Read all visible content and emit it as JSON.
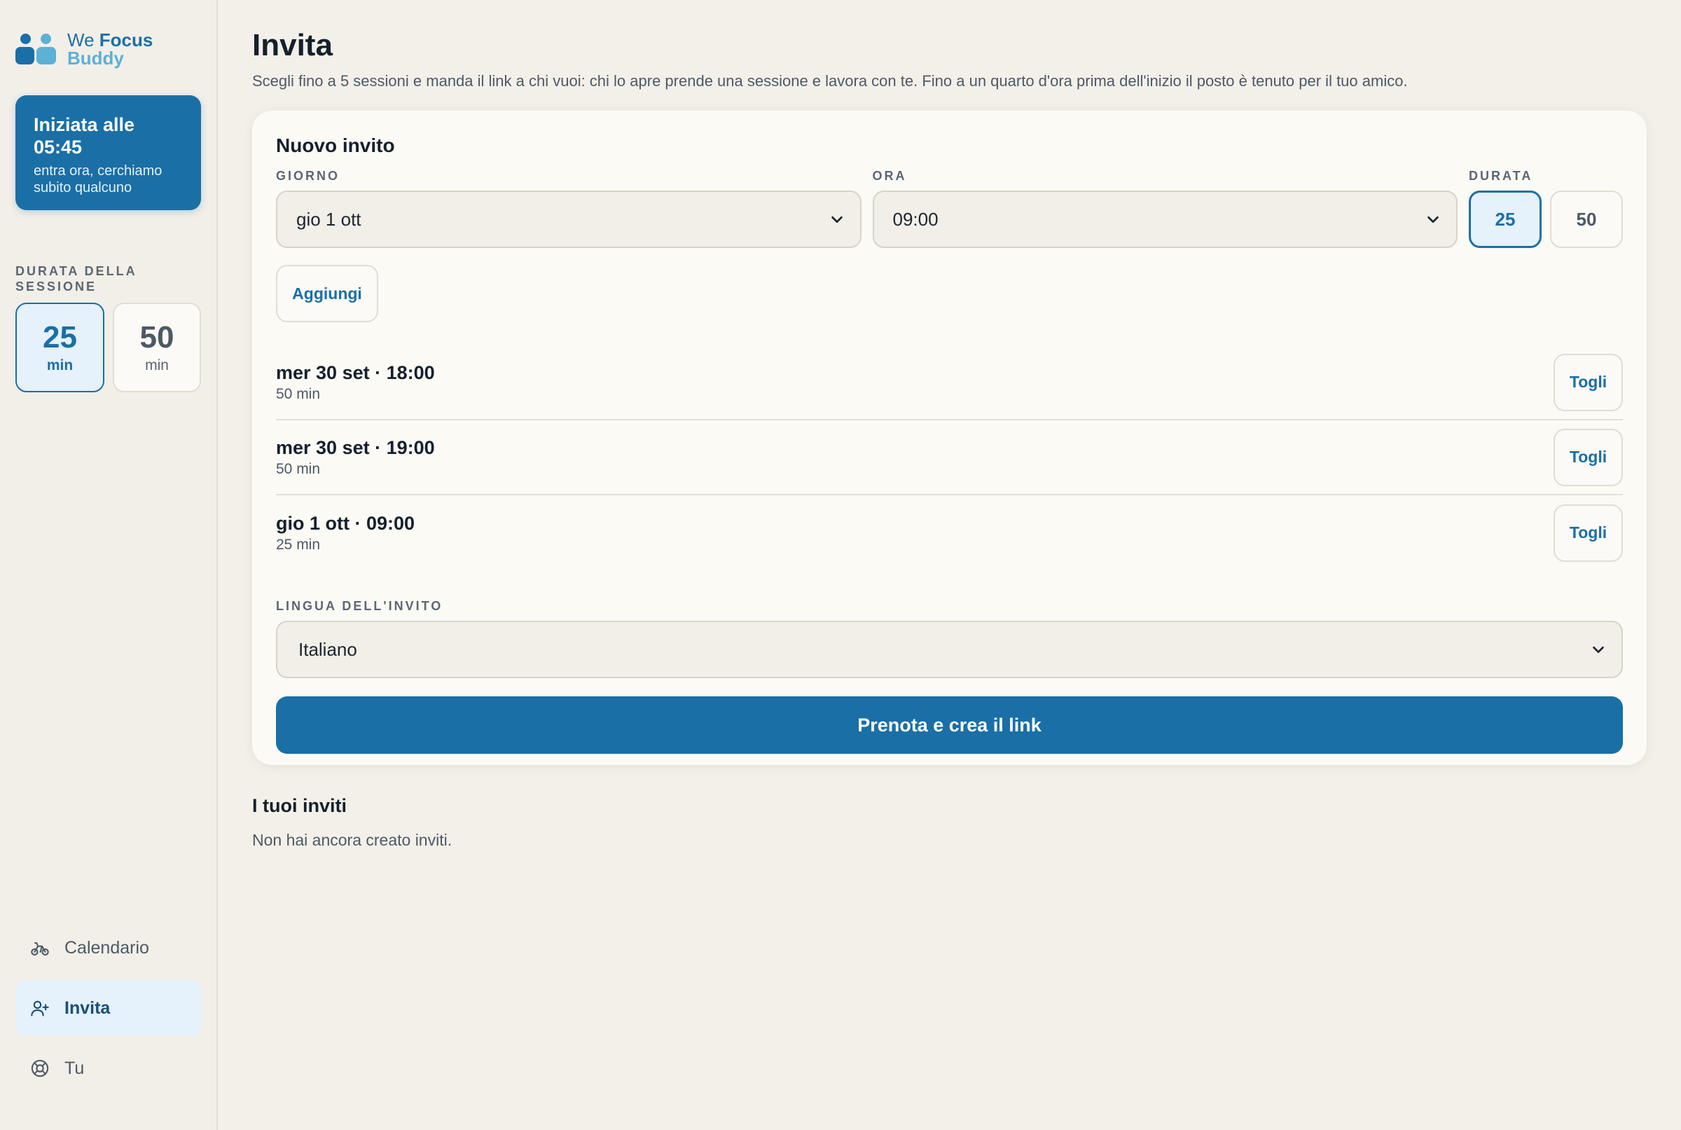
{
  "brand": {
    "we": "We",
    "focus": "Focus",
    "buddy": "Buddy"
  },
  "started_card": {
    "title": "Iniziata alle 05:45",
    "subtitle": "entra ora, cerchiamo subito qualcuno"
  },
  "session_duration": {
    "label": "DURATA DELLA SESSIONE",
    "options": [
      {
        "value": "25",
        "unit": "min",
        "selected": true
      },
      {
        "value": "50",
        "unit": "min",
        "selected": false
      }
    ]
  },
  "nav": [
    {
      "label": "Calendario",
      "icon": "bicycle-icon",
      "active": false
    },
    {
      "label": "Invita",
      "icon": "user-plus-icon",
      "active": true
    },
    {
      "label": "Tu",
      "icon": "lifebuoy-icon",
      "active": false
    }
  ],
  "page": {
    "title": "Invita",
    "subtitle": "Scegli fino a 5 sessioni e manda il link a chi vuoi: chi lo apre prende una sessione e lavora con te. Fino a un quarto d'ora prima dell'inizio il posto è tenuto per il tuo amico."
  },
  "form": {
    "title": "Nuovo invito",
    "day_label": "GIORNO",
    "day_value": "gio 1 ott",
    "time_label": "ORA",
    "time_value": "09:00",
    "duration_label": "DURATA",
    "durations": [
      {
        "value": "25",
        "selected": true
      },
      {
        "value": "50",
        "selected": false
      }
    ],
    "add_label": "Aggiungi",
    "slots": [
      {
        "when": "mer 30 set · 18:00",
        "duration": "50 min",
        "remove_label": "Togli"
      },
      {
        "when": "mer 30 set · 19:00",
        "duration": "50 min",
        "remove_label": "Togli"
      },
      {
        "when": "gio 1 ott · 09:00",
        "duration": "25 min",
        "remove_label": "Togli"
      }
    ],
    "language_label": "LINGUA DELL'INVITO",
    "language_value": "Italiano",
    "submit_label": "Prenota e crea il link"
  },
  "invites": {
    "title": "I tuoi inviti",
    "empty": "Non hai ancora creato inviti."
  },
  "colors": {
    "accent": "#1a6fa6",
    "accent_light": "#5bb1d6",
    "selected_bg": "#e5f1fb"
  }
}
